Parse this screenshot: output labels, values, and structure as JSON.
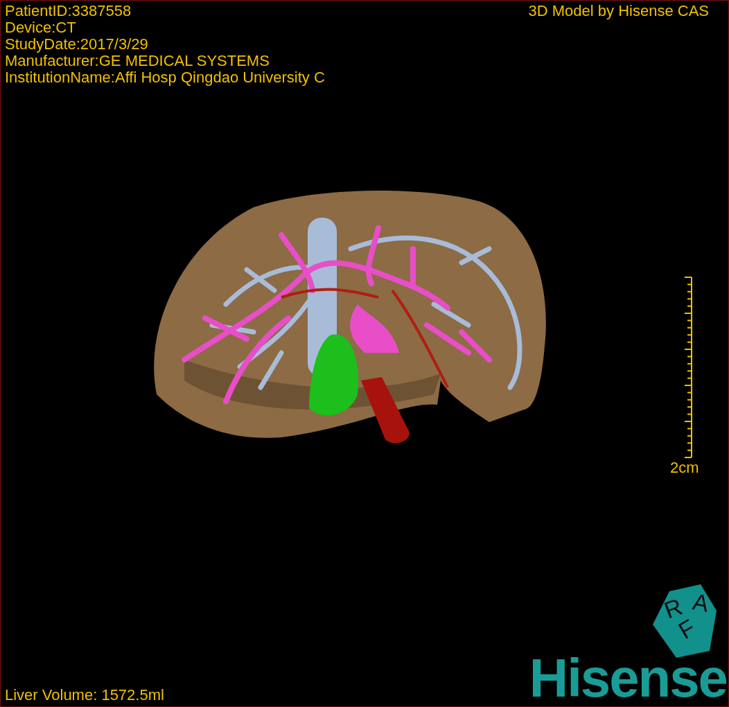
{
  "info_lines": [
    "PatientID:3387558",
    "Device:CT",
    "StudyDate:2017/3/29",
    "Manufacturer:GE MEDICAL SYSTEMS",
    "InstitutionName:Affi Hosp Qingdao University C"
  ],
  "credit": "3D Model by Hisense CAS",
  "scale": {
    "label": "2cm"
  },
  "orientation": [
    "R",
    "A",
    "F"
  ],
  "volume": "Liver Volume: 1572.5ml",
  "logo": "Hisense"
}
